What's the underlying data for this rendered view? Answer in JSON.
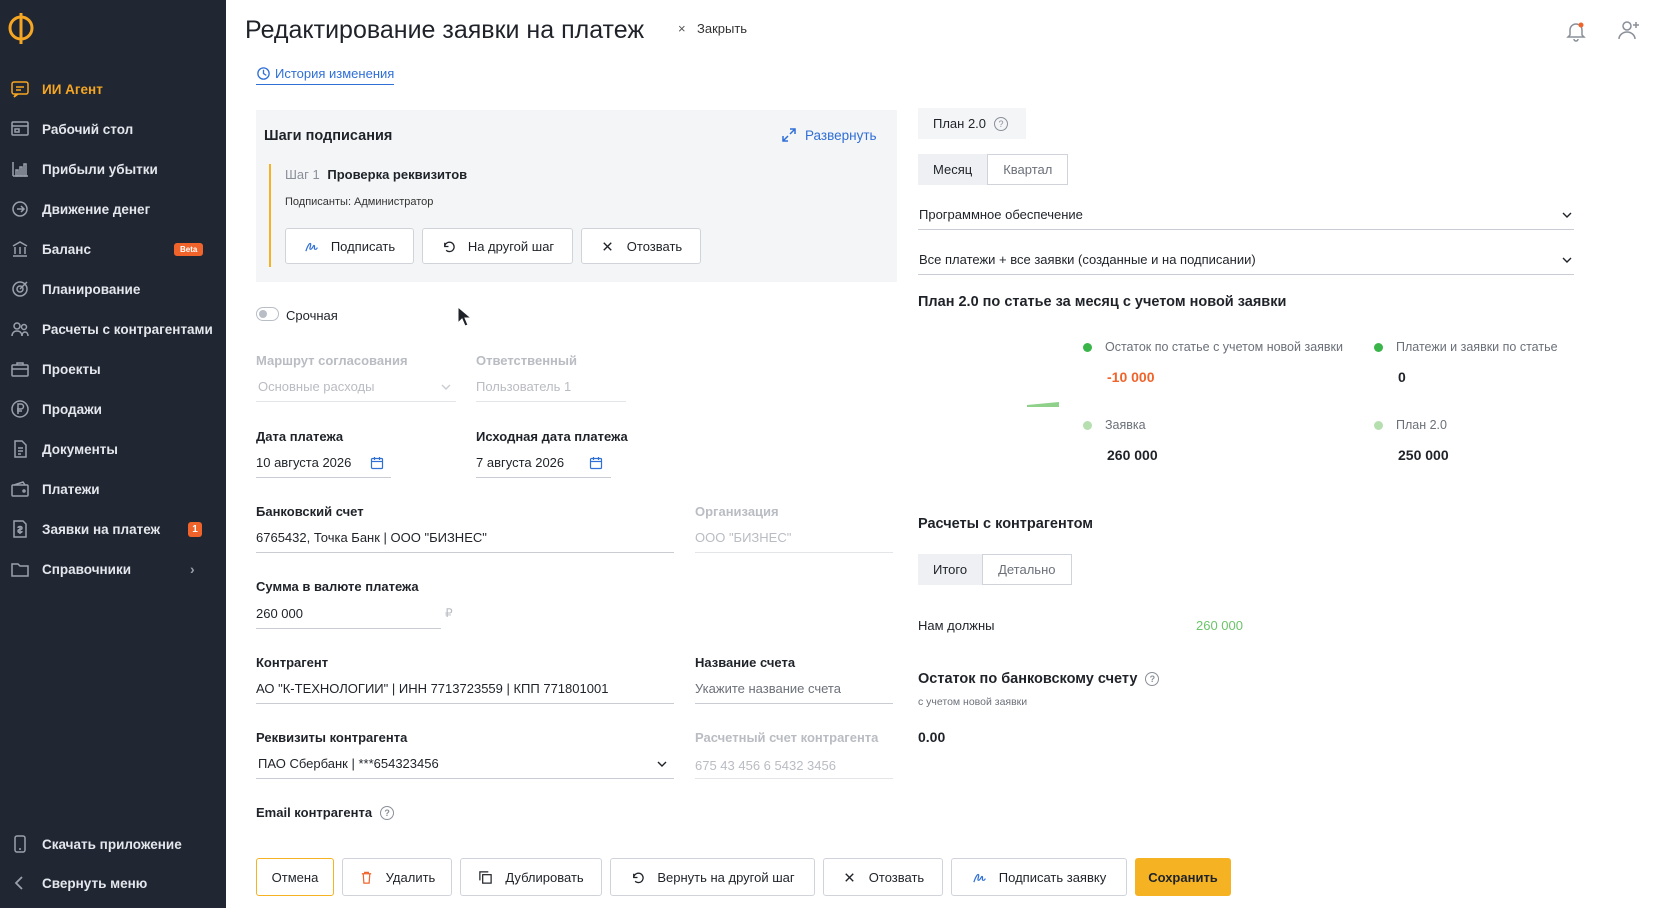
{
  "sidebar": {
    "items": [
      {
        "label": "ИИ Агент",
        "icon": "ai-agent-icon"
      },
      {
        "label": "Рабочий стол",
        "icon": "desktop-icon"
      },
      {
        "label": "Прибыли убытки",
        "icon": "chart-icon"
      },
      {
        "label": "Движение денег",
        "icon": "money-flow-icon"
      },
      {
        "label": "Баланс",
        "icon": "balance-icon",
        "badge": "Beta"
      },
      {
        "label": "Планирование",
        "icon": "planning-icon"
      },
      {
        "label": "Расчеты с контрагентами",
        "icon": "contractors-icon"
      },
      {
        "label": "Проекты",
        "icon": "projects-icon"
      },
      {
        "label": "Продажи",
        "icon": "sales-icon"
      },
      {
        "label": "Документы",
        "icon": "documents-icon"
      },
      {
        "label": "Платежи",
        "icon": "payments-icon"
      },
      {
        "label": "Заявки на платеж",
        "icon": "requests-icon",
        "badge": "1"
      },
      {
        "label": "Справочники",
        "icon": "directories-icon"
      }
    ],
    "download": "Скачать приложение",
    "collapse": "Свернуть меню",
    "accent": "#f5a623"
  },
  "header": {
    "title": "Редактирование заявки на платеж",
    "close_label": "Закрыть",
    "history_link": "История изменения"
  },
  "steps": {
    "title": "Шаги подписания",
    "expand": "Развернуть",
    "step_prefix": "Шаг 1",
    "step_name": "Проверка реквизитов",
    "signers": "Подписанты: Администратор",
    "btn_sign": "Подписать",
    "btn_other_step": "На другой шаг",
    "btn_revoke": "Отозвать"
  },
  "form": {
    "urgent_label": "Срочная",
    "route_label": "Маршрут согласования",
    "route_value": "Основные расходы",
    "responsible_label": "Ответственный",
    "responsible_value": "Пользователь 1",
    "pay_date_label": "Дата платежа",
    "pay_date_value": "10 августа 2026",
    "orig_date_label": "Исходная дата платежа",
    "orig_date_value": "7 августа 2026",
    "bank_label": "Банковский счет",
    "bank_value": "6765432, Точка Банк | ООО \"БИЗНЕС\"",
    "org_label": "Организация",
    "org_value": "ООО \"БИЗНЕС\"",
    "sum_label": "Сумма в валюте платежа",
    "sum_value": "260 000",
    "currency": "₽",
    "contractor_label": "Контрагент",
    "contractor_value": "АО \"К-ТЕХНОЛОГИИ\" | ИНН 7713723559 | КПП 771801001",
    "invoice_label": "Название счета",
    "invoice_placeholder": "Укажите название счета",
    "requisites_label": "Реквизиты контрагента",
    "requisites_value": "ПАО Сбербанк | ***654323456",
    "acc_label": "Расчетный счет контрагента",
    "acc_value": "675 43 456 6 5432 3456",
    "email_label": "Email контрагента"
  },
  "plan": {
    "badge": "План 2.0",
    "tab_month": "Месяц",
    "tab_quarter": "Квартал",
    "select_article": "Программное обеспечение",
    "select_filter": "Все платежи + все заявки (созданные и на подписании)",
    "section_title": "План 2.0 по статье за месяц с учетом новой заявки",
    "legend": [
      {
        "label": "Остаток по статье с учетом новой заявки",
        "value": "-10 000",
        "color": "#3ab54a",
        "value_color": "#f0642c"
      },
      {
        "label": "Платежи и заявки по статье",
        "value": "0",
        "color": "#3ab54a",
        "value_color": "#1f2329"
      },
      {
        "label": "Заявка",
        "value": "260 000",
        "color": "#b6dfb0",
        "value_color": "#1f2329"
      },
      {
        "label": "План 2.0",
        "value": "250 000",
        "color": "#b6dfb0",
        "value_color": "#1f2329"
      }
    ]
  },
  "settlements": {
    "title": "Расчеты с контрагентом",
    "tab_total": "Итого",
    "tab_detail": "Детально",
    "owed_label": "Нам должны",
    "owed_value": "260 000",
    "owed_color": "#6cc46b"
  },
  "bank_balance": {
    "title": "Остаток по банковскому счету",
    "subtitle": "с учетом новой заявки",
    "value": "0.00"
  },
  "footer": {
    "cancel": "Отмена",
    "delete": "Удалить",
    "duplicate": "Дублировать",
    "return_step": "Вернуть на другой шаг",
    "revoke": "Отозвать",
    "sign": "Подписать заявку",
    "save": "Сохранить",
    "save_color": "#f5b323"
  }
}
